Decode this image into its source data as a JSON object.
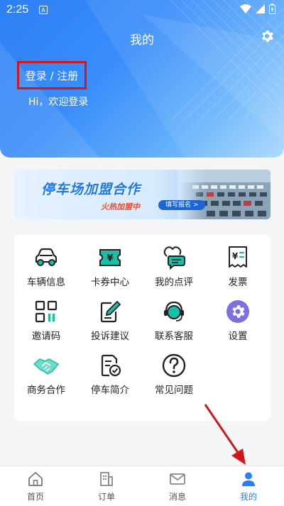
{
  "status_bar": {
    "time": "2:25",
    "notification_icon": "a-notification-icon"
  },
  "header": {
    "title": "我的",
    "login_label": "登录 / 注册",
    "greeting": "Hi，欢迎登录"
  },
  "banner": {
    "title": "停车场加盟合作",
    "subtitle": "火热加盟中",
    "button_label": "填写报名 >"
  },
  "services": [
    {
      "label": "车辆信息",
      "icon": "car-icon"
    },
    {
      "label": "卡券中心",
      "icon": "ticket-icon"
    },
    {
      "label": "我的点评",
      "icon": "comment-icon"
    },
    {
      "label": "发票",
      "icon": "invoice-icon"
    },
    {
      "label": "邀请码",
      "icon": "qrcode-icon"
    },
    {
      "label": "投诉建议",
      "icon": "edit-icon"
    },
    {
      "label": "联系客服",
      "icon": "headset-icon"
    },
    {
      "label": "设置",
      "icon": "settings-icon"
    },
    {
      "label": "商务合作",
      "icon": "handshake-icon"
    },
    {
      "label": "停车简介",
      "icon": "document-icon"
    },
    {
      "label": "常见问题",
      "icon": "question-icon"
    }
  ],
  "bottom_nav": [
    {
      "label": "首页",
      "icon": "home-icon",
      "active": false
    },
    {
      "label": "订单",
      "icon": "order-icon",
      "active": false
    },
    {
      "label": "消息",
      "icon": "message-icon",
      "active": false
    },
    {
      "label": "我的",
      "icon": "user-icon",
      "active": true
    }
  ],
  "colors": {
    "primary": "#2c7ef8",
    "annotation": "#d0171b",
    "teal": "#1abfa9",
    "purple": "#7c6fe0"
  }
}
